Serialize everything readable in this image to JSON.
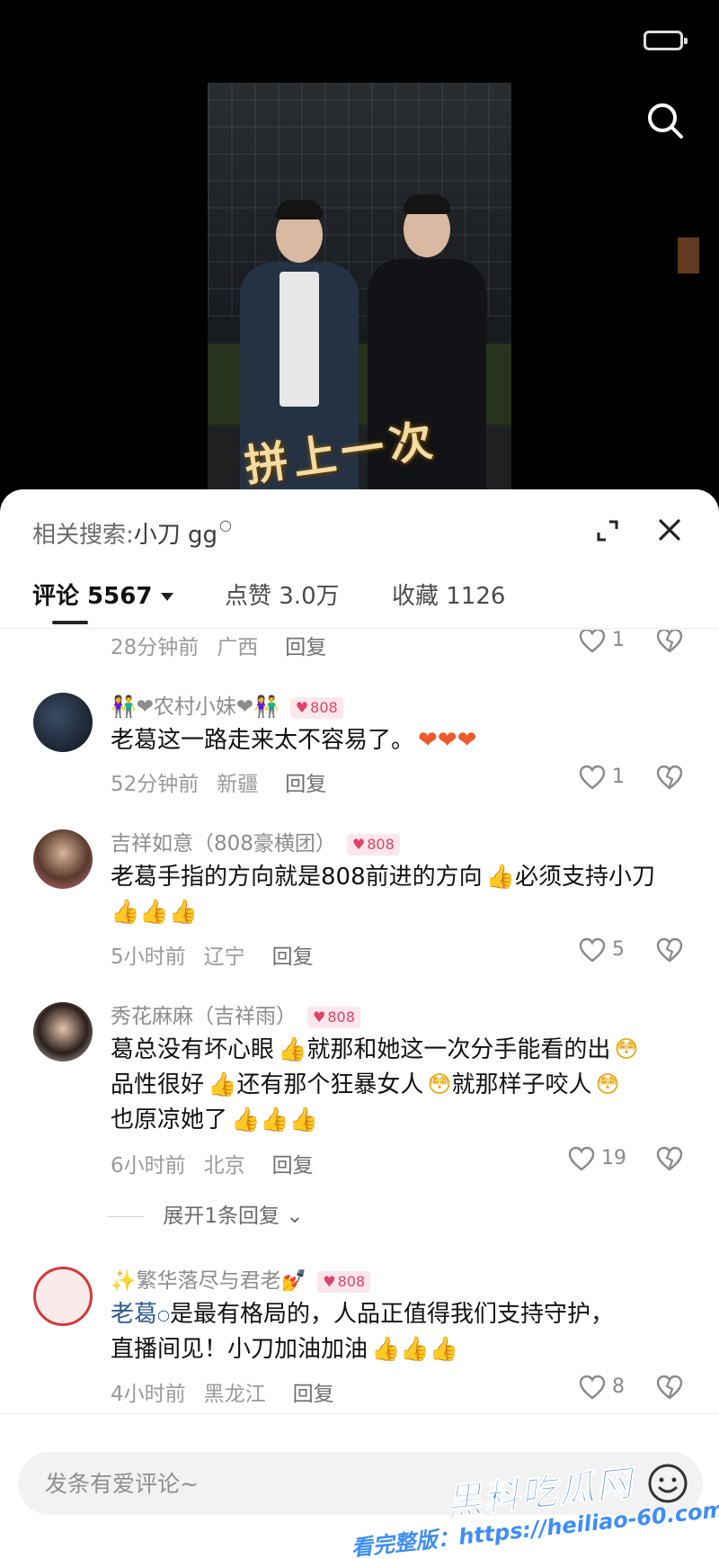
{
  "status_bar": {
    "battery_icon": "battery-icon"
  },
  "video": {
    "caption": "拼上一次",
    "search_icon": "search-icon"
  },
  "sheet": {
    "related_label": "相关搜索:",
    "related_keyword": "小刀 gg",
    "tabs": [
      {
        "label": "评论 5567",
        "active": true
      },
      {
        "label": "点赞 3.0万",
        "active": false
      },
      {
        "label": "收藏 1126",
        "active": false
      }
    ]
  },
  "comments": [
    {
      "partial": true,
      "time": "28分钟前",
      "location": "广西",
      "reply_label": "回复",
      "likes": "1"
    },
    {
      "username": "👫❤农村小妹❤👫",
      "badge": "808",
      "text": "老葛这一路走来太不容易了。",
      "emojis": "❤❤❤",
      "time": "52分钟前",
      "location": "新疆",
      "reply_label": "回复",
      "likes": "1"
    },
    {
      "username": "吉祥如意（808豪横团）",
      "badge": "808",
      "text_part1": "老葛手指的方向就是808前进的方向",
      "text_part2": "必须支持小刀",
      "time": "5小时前",
      "location": "辽宁",
      "reply_label": "回复",
      "likes": "5"
    },
    {
      "username": "秀花麻麻（吉祥雨）",
      "badge": "808",
      "text_part1": "葛总没有坏心眼",
      "text_part2": "就那和她这一次分手能看的出",
      "text_part3": "品性很好",
      "text_part4": "还有那个狂暴女人",
      "text_part5": "就那样子咬人",
      "text_part6": "也原凉她了",
      "time": "6小时前",
      "location": "北京",
      "reply_label": "回复",
      "likes": "19",
      "expand_replies": "展开1条回复"
    },
    {
      "username": "✨繁华落尽与君老💅",
      "badge": "808",
      "keyword": "老葛",
      "text_part1": "是最有格局的，人品正值得我们支持守护，",
      "text_part2": "直播间见！小刀加油加油",
      "time": "4小时前",
      "location": "黑龙江",
      "reply_label": "回复",
      "likes": "8"
    }
  ],
  "input": {
    "placeholder": "发条有爱评论~",
    "emoji_icon": "emoji-icon"
  },
  "watermark": {
    "logo": "黑料吃瓜网",
    "url": "看完整版：https://heiliao-60.com"
  }
}
